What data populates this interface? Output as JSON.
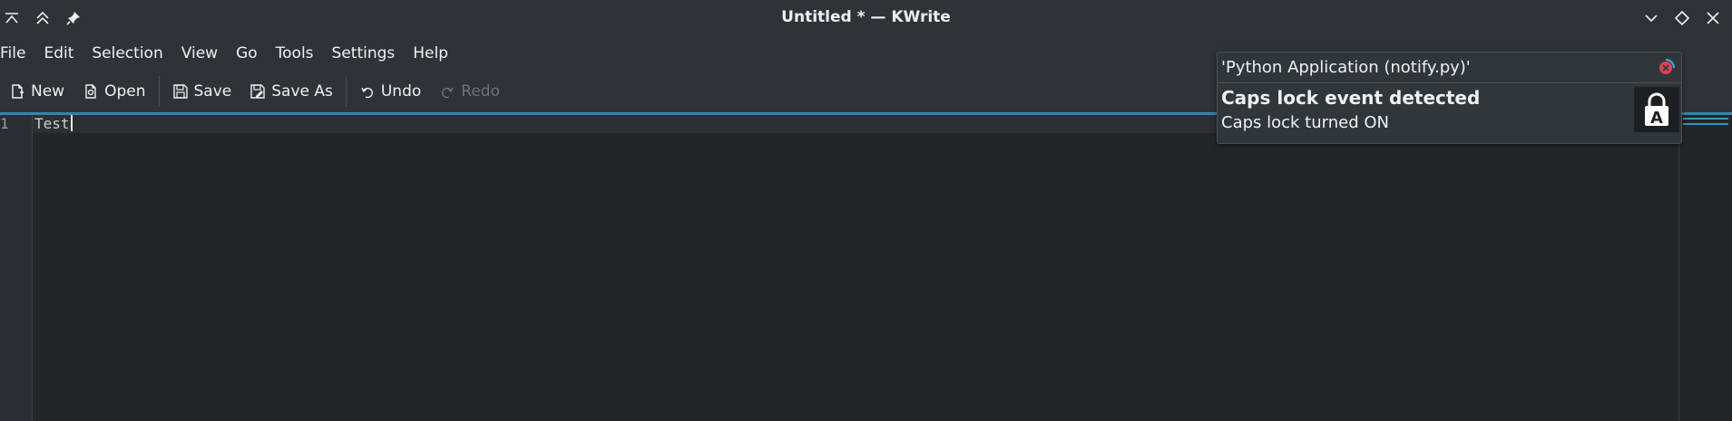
{
  "window": {
    "title": "Untitled * — KWrite"
  },
  "menu": [
    "File",
    "Edit",
    "Selection",
    "View",
    "Go",
    "Tools",
    "Settings",
    "Help"
  ],
  "toolbar": {
    "new": "New",
    "open": "Open",
    "save": "Save",
    "save_as": "Save As",
    "undo": "Undo",
    "redo": "Redo"
  },
  "editor": {
    "line_number": "1",
    "text": "Test"
  },
  "notification": {
    "app_name": "'Python Application (notify.py)'",
    "summary": "Caps lock event detected",
    "body": "Caps lock turned ON",
    "icon": "caps-lock-icon"
  },
  "colors": {
    "accent": "#3daee9",
    "close": "#da4453"
  }
}
